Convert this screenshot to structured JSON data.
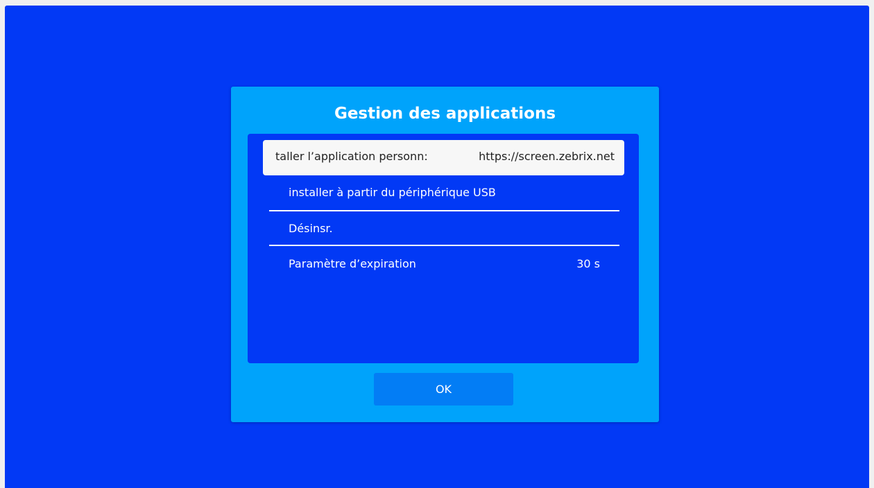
{
  "dialog": {
    "title": "Gestion des applications",
    "ok_label": "OK"
  },
  "menu": {
    "items": [
      {
        "label": "taller l’application personn:",
        "value": "https://screen.zebrix.net",
        "selected": true
      },
      {
        "label": "installer à partir du périphérique USB",
        "value": ""
      },
      {
        "label": "Désinsr.",
        "value": ""
      },
      {
        "label": "Paramètre d’expiration",
        "value": "30 s"
      }
    ]
  },
  "colors": {
    "background": "#0239f5",
    "dialog": "#00a3fb",
    "panel": "#0239f5",
    "selected_row": "#f7f7f7",
    "button": "#037df5",
    "text": "#ffffff"
  }
}
